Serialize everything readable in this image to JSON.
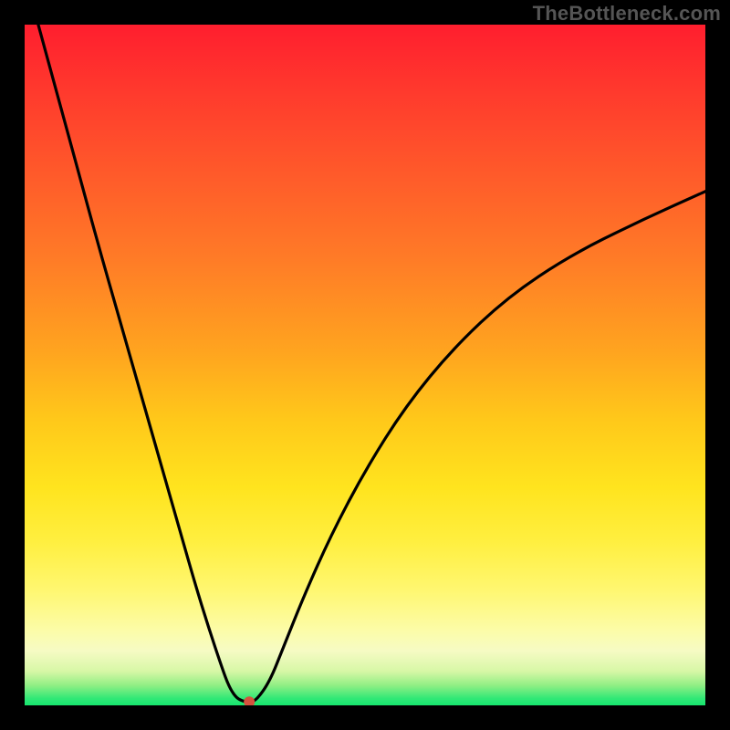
{
  "watermark": "TheBottleneck.com",
  "chart_data": {
    "type": "line",
    "title": "",
    "xlabel": "",
    "ylabel": "",
    "xlim": [
      0,
      100
    ],
    "ylim": [
      0,
      100
    ],
    "legend": false,
    "grid": false,
    "background": "red-yellow-green vertical gradient",
    "series": [
      {
        "name": "bottleneck-curve",
        "x": [
          2,
          5,
          8,
          11,
          14,
          17,
          20,
          23,
          25,
          27,
          29,
          30,
          31,
          32,
          33,
          34,
          36,
          38,
          41,
          45,
          50,
          56,
          63,
          71,
          80,
          90,
          100
        ],
        "values": [
          100,
          89,
          78,
          67,
          56.5,
          46,
          35.5,
          25,
          18,
          11.5,
          5.5,
          2.8,
          1.2,
          0.6,
          0.5,
          0.7,
          3.5,
          8.5,
          16,
          25,
          34.5,
          44,
          52.5,
          60,
          66,
          71,
          75.5
        ]
      }
    ],
    "annotations": [
      {
        "name": "minimum-point",
        "x": 33,
        "y": 0.5,
        "marker": "dot",
        "color": "#d5523e"
      }
    ]
  }
}
